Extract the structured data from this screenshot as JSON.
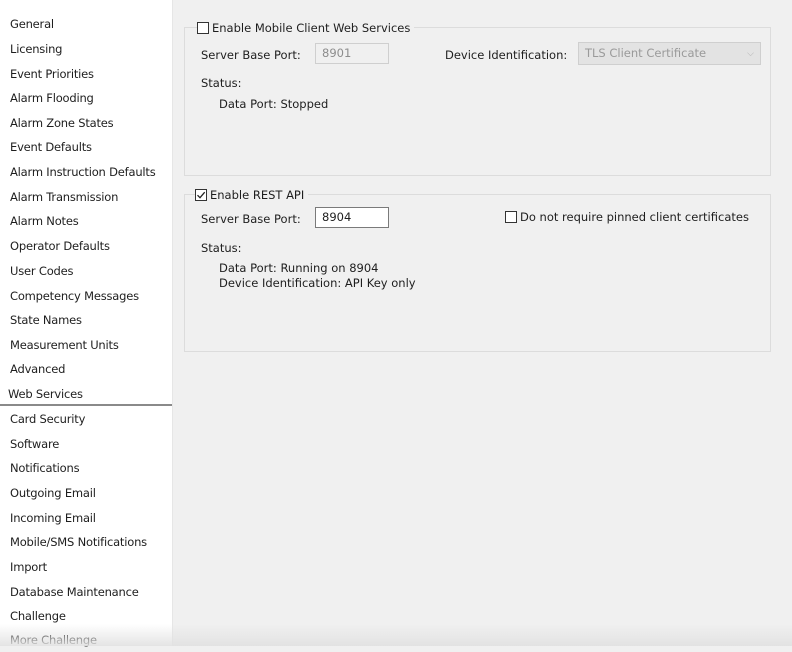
{
  "sidebar": {
    "selected_index": 16,
    "items": [
      {
        "label": "General"
      },
      {
        "label": "Licensing"
      },
      {
        "label": "Event Priorities"
      },
      {
        "label": "Alarm Flooding"
      },
      {
        "label": "Alarm Zone States"
      },
      {
        "label": "Event Defaults"
      },
      {
        "label": "Alarm Instruction Defaults"
      },
      {
        "label": "Alarm Transmission"
      },
      {
        "label": "Alarm Notes"
      },
      {
        "label": "Operator Defaults"
      },
      {
        "label": "User Codes"
      },
      {
        "label": "Competency Messages"
      },
      {
        "label": "State Names"
      },
      {
        "label": "Measurement Units"
      },
      {
        "label": "Advanced"
      },
      {
        "label": "Web Services"
      },
      {
        "label": "Card Security"
      },
      {
        "label": "Software"
      },
      {
        "label": "Notifications"
      },
      {
        "label": "Outgoing Email"
      },
      {
        "label": "Incoming Email"
      },
      {
        "label": "Mobile/SMS Notifications"
      },
      {
        "label": "Import"
      },
      {
        "label": "Database Maintenance"
      },
      {
        "label": "Challenge"
      },
      {
        "label": "More Challenge"
      }
    ]
  },
  "mobile": {
    "enable_label": "Enable Mobile Client Web Services",
    "enabled": false,
    "port_label": "Server Base Port:",
    "port_value": "8901",
    "device_id_label": "Device Identification:",
    "device_id_value": "TLS Client Certificate",
    "status_label": "Status:",
    "status_line": "Data Port: Stopped"
  },
  "rest": {
    "enable_label": "Enable REST API",
    "enabled": true,
    "port_label": "Server Base Port:",
    "port_value": "8904",
    "pinned_label": "Do not require pinned client certificates",
    "pinned_checked": false,
    "status_label": "Status:",
    "status_line_1": "Data Port: Running on 8904",
    "status_line_2": "Device Identification: API Key only"
  },
  "icons": {
    "check": "check-icon",
    "dropdown": "chevron-down-icon"
  },
  "colors": {
    "background": "#f0f0f0",
    "sidebar": "#ffffff",
    "border": "#dcdcdc"
  }
}
